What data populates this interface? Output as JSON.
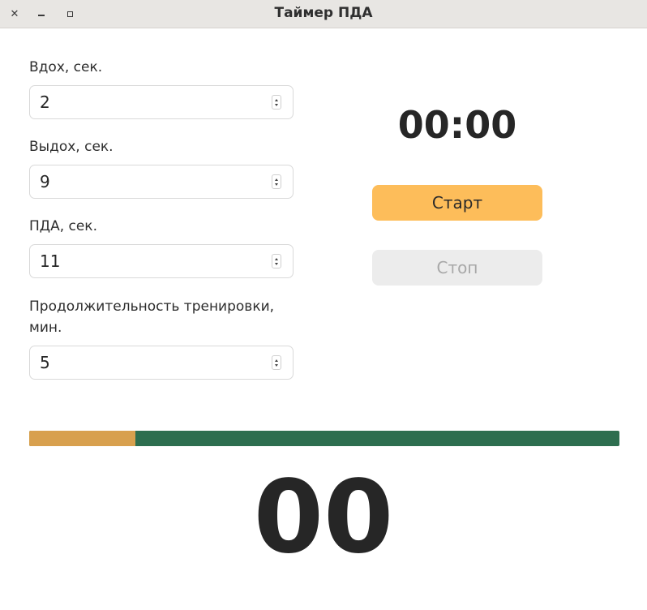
{
  "window": {
    "title": "Таймер ПДА",
    "close_glyph": "✕"
  },
  "settings": {
    "inhale": {
      "label": "Вдох, сек.",
      "value": "2"
    },
    "exhale": {
      "label": "Выдох, сек.",
      "value": "9"
    },
    "pda": {
      "label": "ПДА, сек.",
      "value": "11"
    },
    "duration": {
      "label_line1": "Продолжительность тренировки,",
      "label_line2": "мин.",
      "value": "5"
    }
  },
  "timer": {
    "clock": "00:00",
    "start_label": "Старт",
    "stop_label": "Стоп",
    "counter": "00"
  },
  "progress": {
    "fraction": 0.18,
    "fill_color": "#d8a04e",
    "track_color": "#2d6e4f"
  },
  "colors": {
    "start_button": "#fdbd5a",
    "stop_button_disabled": "#ececec"
  }
}
